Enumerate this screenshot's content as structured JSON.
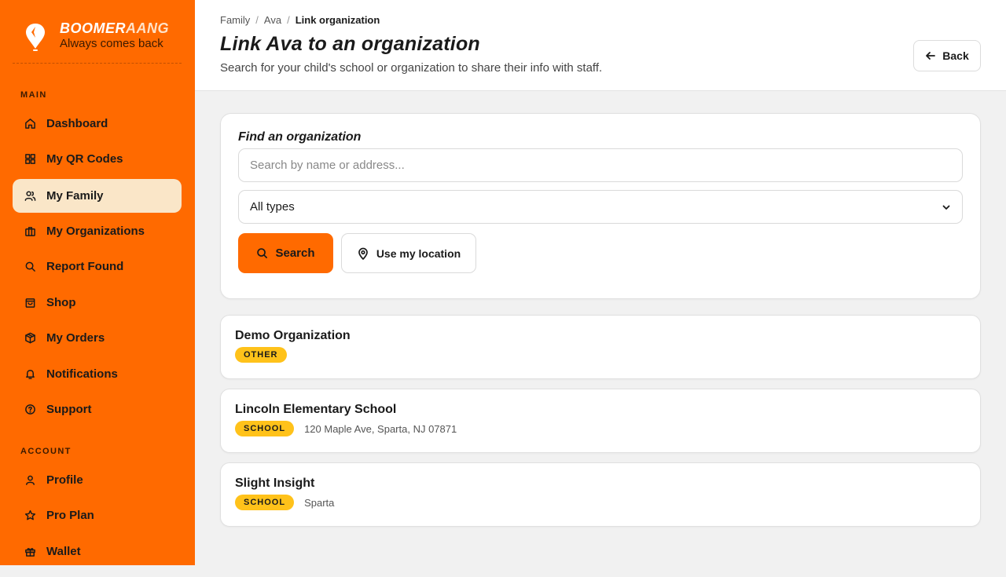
{
  "brand": {
    "name_main": "BOOMER",
    "name_accent": "AANG",
    "tagline": "Always comes back"
  },
  "sidebar": {
    "main_label": "MAIN",
    "account_label": "ACCOUNT",
    "main_items": [
      {
        "label": "Dashboard",
        "icon": "home-icon"
      },
      {
        "label": "My QR Codes",
        "icon": "grid-icon"
      },
      {
        "label": "My Family",
        "icon": "users-icon",
        "active": true
      },
      {
        "label": "My Organizations",
        "icon": "briefcase-icon"
      },
      {
        "label": "Report Found",
        "icon": "search-icon"
      },
      {
        "label": "Shop",
        "icon": "shopping-bag-icon"
      },
      {
        "label": "My Orders",
        "icon": "package-icon"
      },
      {
        "label": "Notifications",
        "icon": "bell-icon"
      },
      {
        "label": "Support",
        "icon": "help-circle-icon"
      }
    ],
    "account_items": [
      {
        "label": "Profile",
        "icon": "user-icon"
      },
      {
        "label": "Pro Plan",
        "icon": "star-icon"
      },
      {
        "label": "Wallet",
        "icon": "gift-icon"
      }
    ]
  },
  "header": {
    "breadcrumb": [
      "Family",
      "Ava",
      "Link organization"
    ],
    "title": "Link Ava to an organization",
    "subtitle": "Search for your child's school or organization to share their info with staff.",
    "back_label": "Back"
  },
  "search": {
    "title": "Find an organization",
    "placeholder": "Search by name or address...",
    "value": "",
    "type_selected": "All types",
    "search_label": "Search",
    "location_label": "Use my location"
  },
  "results": [
    {
      "name": "Demo Organization",
      "type": "OTHER",
      "address": ""
    },
    {
      "name": "Lincoln Elementary School",
      "type": "SCHOOL",
      "address": "120 Maple Ave, Sparta, NJ 07871"
    },
    {
      "name": "Slight Insight",
      "type": "SCHOOL",
      "address": "Sparta"
    }
  ],
  "colors": {
    "brand_orange": "#ff6a00",
    "active_nav_bg": "#fae6c8",
    "badge_yellow": "#ffc21a"
  }
}
